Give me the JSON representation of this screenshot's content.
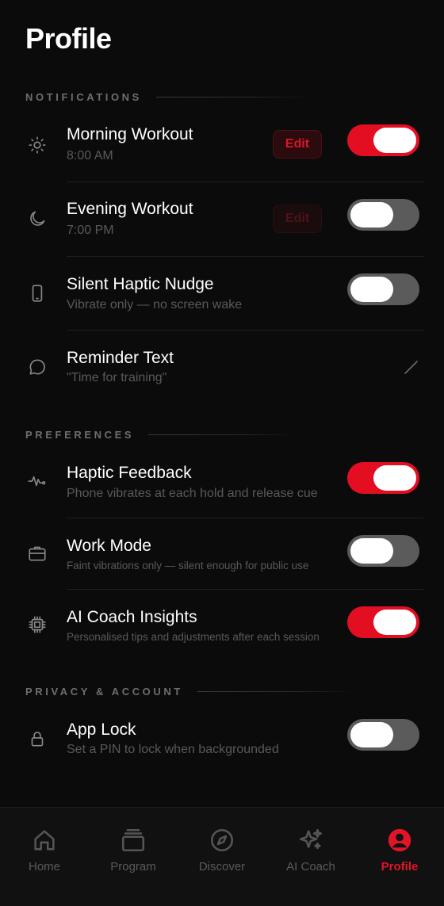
{
  "page": {
    "title": "Profile"
  },
  "sections": {
    "notifications": "NOTIFICATIONS",
    "preferences": "PREFERENCES",
    "privacy": "PRIVACY & ACCOUNT"
  },
  "notifications": {
    "morning": {
      "title": "Morning Workout",
      "subtitle": "8:00 AM",
      "edit_label": "Edit",
      "enabled": true
    },
    "evening": {
      "title": "Evening Workout",
      "subtitle": "7:00 PM",
      "edit_label": "Edit",
      "enabled": false
    },
    "haptic_nudge": {
      "title": "Silent Haptic Nudge",
      "subtitle": "Vibrate only — no screen wake",
      "enabled": false
    },
    "reminder_text": {
      "title": "Reminder Text",
      "subtitle": "\"Time for training\""
    }
  },
  "preferences": {
    "haptic_feedback": {
      "title": "Haptic Feedback",
      "subtitle": "Phone vibrates at each hold and release cue",
      "enabled": true
    },
    "work_mode": {
      "title": "Work Mode",
      "subtitle": "Faint vibrations only — silent enough for public use",
      "enabled": false
    },
    "ai_insights": {
      "title": "AI Coach Insights",
      "subtitle": "Personalised tips and adjustments after each session",
      "enabled": true
    }
  },
  "privacy": {
    "app_lock": {
      "title": "App Lock",
      "subtitle": "Set a PIN to lock when backgrounded",
      "enabled": false
    }
  },
  "tabbar": {
    "active": "Profile",
    "tabs": [
      {
        "label": "Home",
        "icon": "home-icon"
      },
      {
        "label": "Program",
        "icon": "stack-icon"
      },
      {
        "label": "Discover",
        "icon": "compass-icon"
      },
      {
        "label": "AI Coach",
        "icon": "sparkles-icon"
      },
      {
        "label": "Profile",
        "icon": "user-circle-icon"
      }
    ]
  },
  "colors": {
    "accent": "#e30e22",
    "background": "#0b0b0b",
    "toggle_off": "#5b5b5b"
  }
}
